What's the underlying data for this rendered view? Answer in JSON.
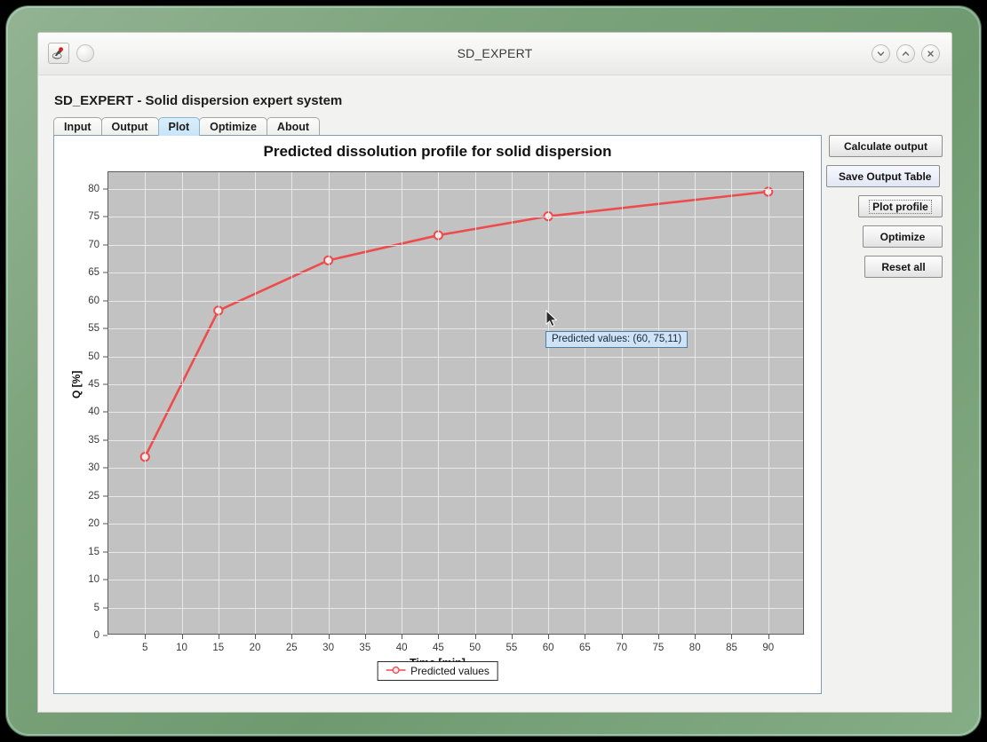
{
  "window": {
    "title": "SD_EXPERT",
    "app_icon": "java-app-icon",
    "controls": {
      "minimize": "chevron-down-icon",
      "maximize": "chevron-up-icon",
      "close": "close-icon"
    }
  },
  "app": {
    "heading": "SD_EXPERT - Solid dispersion expert system",
    "tabs": [
      {
        "label": "Input",
        "selected": false
      },
      {
        "label": "Output",
        "selected": false
      },
      {
        "label": "Plot",
        "selected": true
      },
      {
        "label": "Optimize",
        "selected": false
      },
      {
        "label": "About",
        "selected": false
      }
    ]
  },
  "sidebar": {
    "buttons": [
      {
        "label": "Calculate output",
        "focused": false,
        "highlight": false
      },
      {
        "label": "Save Output Table",
        "focused": false,
        "highlight": true
      },
      {
        "label": "Plot profile",
        "focused": true,
        "highlight": false
      },
      {
        "label": "Optimize",
        "focused": false,
        "highlight": false
      },
      {
        "label": "Reset all",
        "focused": false,
        "highlight": false
      }
    ]
  },
  "tooltip": {
    "text": "Predicted values: (60, 75,11)"
  },
  "colors": {
    "series": "#ee4c4c",
    "marker_fill": "#fdecec",
    "plot_background": "#c2c2c2",
    "gridline": "#e8e8e8",
    "frame_green": "#7da47d",
    "tab_selected": "#c7e4f8"
  },
  "chart_data": {
    "type": "line",
    "title": "Predicted dissolution profile for solid dispersion",
    "xlabel": "Time [min]",
    "ylabel": "Q [%]",
    "xlim": [
      0,
      95
    ],
    "ylim": [
      0,
      83
    ],
    "xticks": [
      5,
      10,
      15,
      20,
      25,
      30,
      35,
      40,
      45,
      50,
      55,
      60,
      65,
      70,
      75,
      80,
      85,
      90
    ],
    "yticks": [
      0,
      5,
      10,
      15,
      20,
      25,
      30,
      35,
      40,
      45,
      50,
      55,
      60,
      65,
      70,
      75,
      80
    ],
    "grid": true,
    "legend": "bottom",
    "series": [
      {
        "name": "Predicted values",
        "x": [
          5,
          15,
          30,
          45,
          60,
          90
        ],
        "values": [
          32.0,
          58.2,
          67.2,
          71.7,
          75.11,
          79.5
        ]
      }
    ]
  }
}
